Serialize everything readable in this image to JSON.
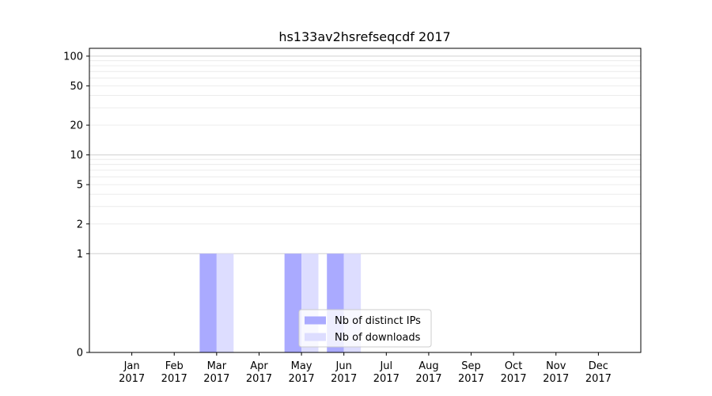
{
  "chart_data": {
    "type": "bar",
    "title": "hs133av2hsrefseqcdf 2017",
    "categories": [
      "Jan\n2017",
      "Feb\n2017",
      "Mar\n2017",
      "Apr\n2017",
      "May\n2017",
      "Jun\n2017",
      "Jul\n2017",
      "Aug\n2017",
      "Sep\n2017",
      "Oct\n2017",
      "Nov\n2017",
      "Dec\n2017"
    ],
    "series": [
      {
        "name": "Nb of distinct IPs",
        "color": "#aaaaff",
        "values": [
          0,
          0,
          1,
          0,
          1,
          1,
          0,
          0,
          0,
          0,
          0,
          0
        ]
      },
      {
        "name": "Nb of downloads",
        "color": "#ddddff",
        "values": [
          0,
          0,
          1,
          0,
          1,
          1,
          0,
          0,
          0,
          0,
          0,
          0
        ]
      }
    ],
    "yscale": "symlog",
    "ylim": [
      0,
      120
    ],
    "yticks": [
      0,
      1,
      2,
      5,
      10,
      20,
      50,
      100
    ],
    "grid": true,
    "legend_position": "lower center"
  }
}
